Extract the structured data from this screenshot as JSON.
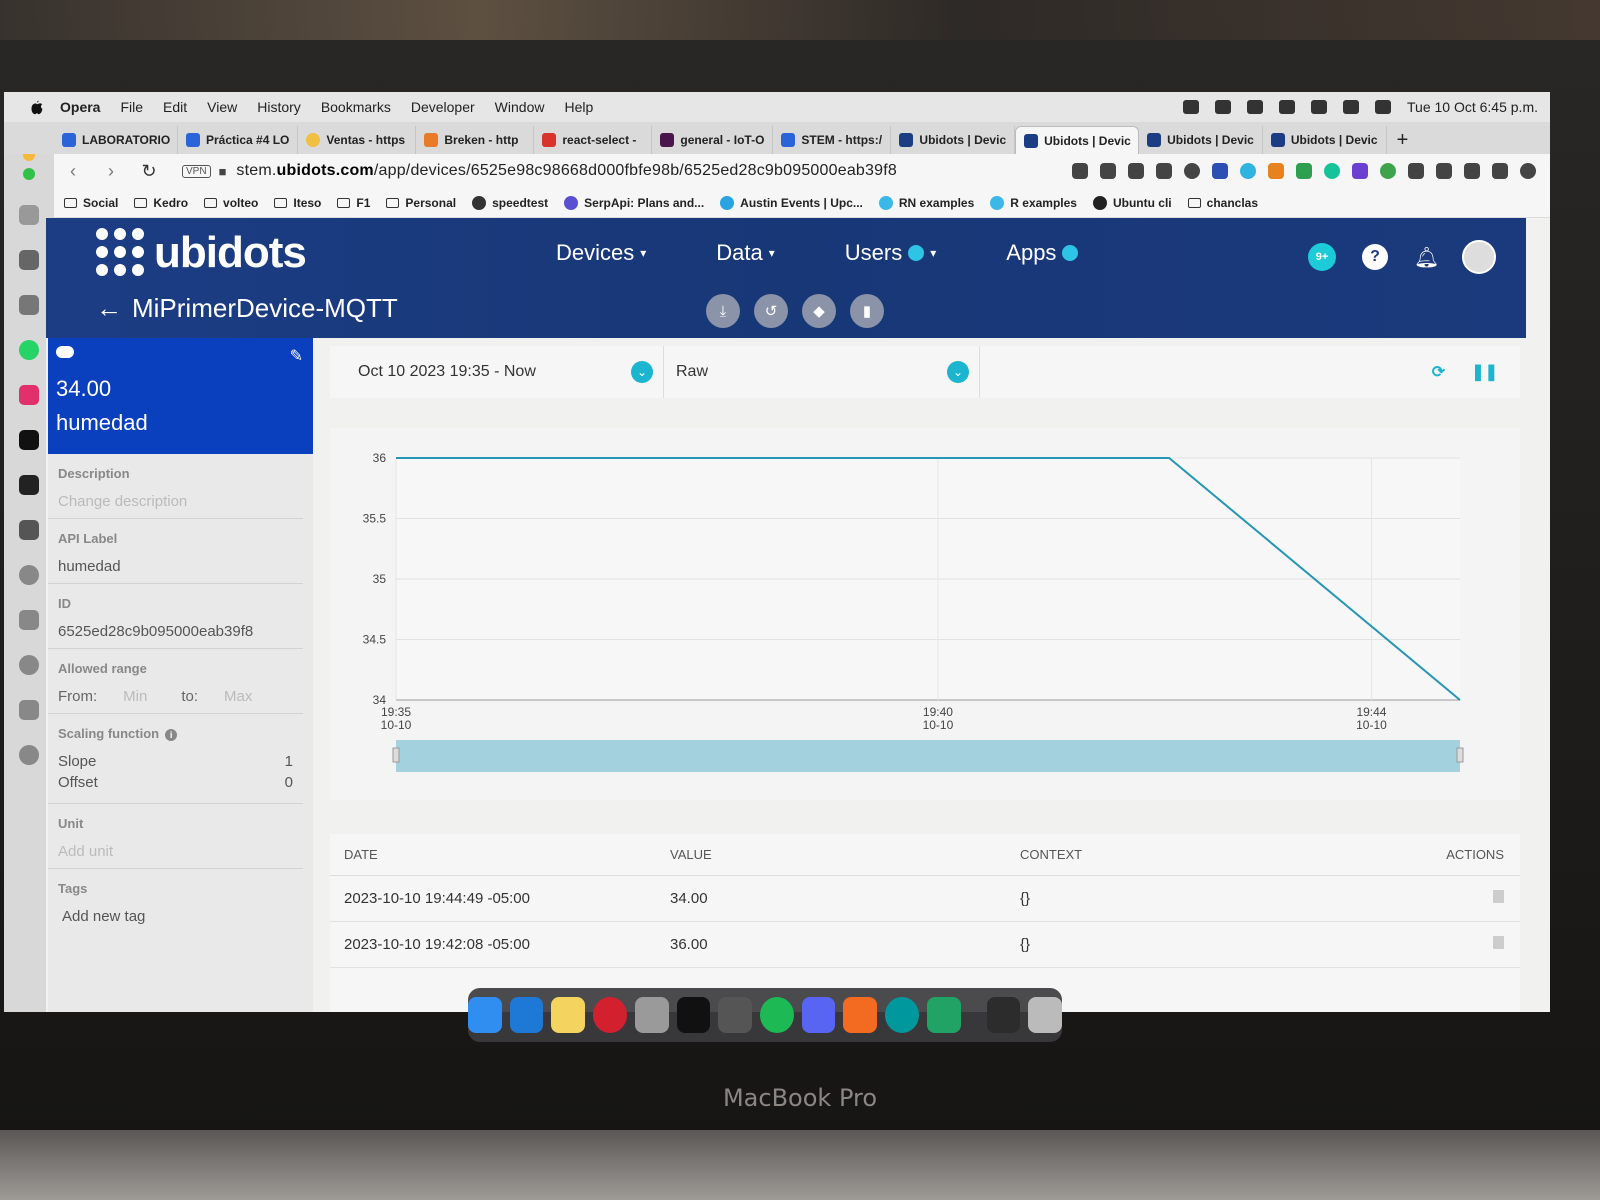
{
  "mac_menu": {
    "app": "Opera",
    "items": [
      "File",
      "Edit",
      "View",
      "History",
      "Bookmarks",
      "Developer",
      "Window",
      "Help"
    ],
    "clock": "Tue 10 Oct  6:45 p.m."
  },
  "tabs": [
    {
      "label": "LABORATORIO",
      "color": "#2b63d9"
    },
    {
      "label": "Práctica #4 LO",
      "color": "#2b63d9"
    },
    {
      "label": "Ventas - https",
      "color": "#f0c040"
    },
    {
      "label": "Breken - http",
      "color": "#e87a2a"
    },
    {
      "label": "react-select -",
      "color": "#d9342b"
    },
    {
      "label": "general - IoT-O",
      "color": "#4a154b"
    },
    {
      "label": "STEM - https:/",
      "color": "#2b63d9"
    },
    {
      "label": "Ubidots | Devic",
      "color": "#1c3d84"
    },
    {
      "label": "Ubidots | Devic",
      "color": "#1c3d84",
      "active": true
    },
    {
      "label": "Ubidots | Devic",
      "color": "#1c3d84"
    },
    {
      "label": "Ubidots | Devic",
      "color": "#1c3d84"
    }
  ],
  "address": {
    "vpn": "VPN",
    "url_prefix": "stem.",
    "url_domain": "ubidots.com",
    "url_path": "/app/devices/6525e98c98668d000fbfe98b/6525ed28c9b095000eab39f8"
  },
  "bookmarks": [
    {
      "label": "Social",
      "type": "folder"
    },
    {
      "label": "Kedro",
      "type": "folder"
    },
    {
      "label": "volteo",
      "type": "folder"
    },
    {
      "label": "Iteso",
      "type": "folder"
    },
    {
      "label": "F1",
      "type": "folder"
    },
    {
      "label": "Personal",
      "type": "folder"
    },
    {
      "label": "speedtest",
      "type": "link",
      "color": "#333333"
    },
    {
      "label": "SerpApi: Plans and...",
      "type": "link",
      "color": "#5b4fd1"
    },
    {
      "label": "Austin Events | Upc...",
      "type": "link",
      "color": "#2aa3e0"
    },
    {
      "label": "RN examples",
      "type": "link",
      "color": "#3bb7e8"
    },
    {
      "label": "R examples",
      "type": "link",
      "color": "#3bb7e8"
    },
    {
      "label": "Ubuntu cli",
      "type": "link",
      "color": "#222222"
    },
    {
      "label": "chanclas",
      "type": "folder"
    }
  ],
  "ubidots": {
    "logo": "ubidots",
    "menu": [
      "Devices",
      "Data",
      "Users",
      "Apps"
    ],
    "notif_badge": "9+",
    "help": "?",
    "device_title": "MiPrimerDevice-MQTT"
  },
  "variable": {
    "value": "34.00",
    "name": "humedad",
    "description_label": "Description",
    "description_placeholder": "Change description",
    "api_label_label": "API Label",
    "api_label": "humedad",
    "id_label": "ID",
    "id": "6525ed28c9b095000eab39f8",
    "range_label": "Allowed range",
    "range_from": "From:",
    "range_min": "Min",
    "range_to": "to:",
    "range_max": "Max",
    "scaling_label": "Scaling function",
    "slope_label": "Slope",
    "slope": "1",
    "offset_label": "Offset",
    "offset": "0",
    "unit_label": "Unit",
    "unit_placeholder": "Add unit",
    "tags_label": "Tags",
    "tags_add": "Add new tag"
  },
  "filters": {
    "date_range": "Oct 10 2023 19:35 - Now",
    "mode": "Raw"
  },
  "chart_data": {
    "type": "line",
    "x": [
      "19:35",
      "19:42:08",
      "19:44:49"
    ],
    "y": [
      36,
      36,
      34
    ],
    "ylim": [
      34,
      36
    ],
    "yticks": [
      "36",
      "35.5",
      "35",
      "34.5",
      "34"
    ],
    "xticks": [
      {
        "time": "19:35",
        "date": "10-10"
      },
      {
        "time": "19:40",
        "date": "10-10"
      },
      {
        "time": "19:44",
        "date": "10-10"
      }
    ],
    "line_color": "#2596b5",
    "grid": true
  },
  "table": {
    "headers": [
      "DATE",
      "VALUE",
      "CONTEXT",
      "ACTIONS"
    ],
    "rows": [
      {
        "date": "2023-10-10 19:44:49 -05:00",
        "value": "34.00",
        "context": "{}"
      },
      {
        "date": "2023-10-10 19:42:08 -05:00",
        "value": "36.00",
        "context": "{}"
      }
    ]
  },
  "laptop_brand": "MacBook Pro"
}
